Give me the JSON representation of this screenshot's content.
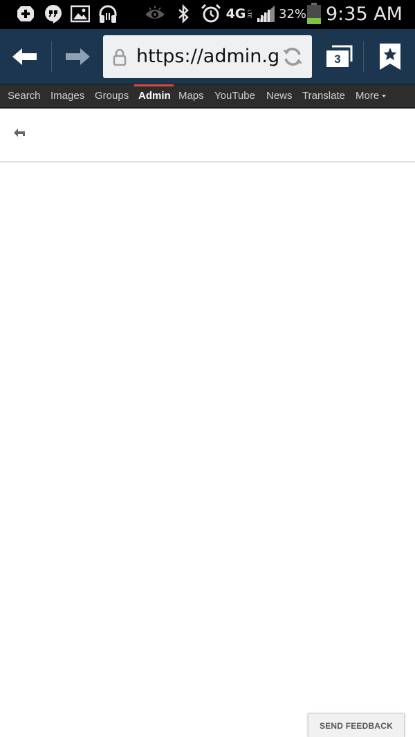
{
  "status_bar": {
    "icons": [
      "google-plus-icon",
      "hangouts-icon",
      "gallery-icon",
      "headphones-icon",
      "eye-icon",
      "bluetooth-icon",
      "alarm-icon",
      "4g-lte-icon",
      "signal-icon",
      "battery-icon"
    ],
    "network": "4G",
    "network_sub": "LTE",
    "battery_percent": "32%",
    "battery_level": 0.32,
    "time": "9:35 AM"
  },
  "browser": {
    "url": "https://admin.google.com",
    "tab_count": "3",
    "colors": {
      "toolbar": "#1d3650",
      "url_box": "#eef0f2"
    }
  },
  "google_bar": {
    "items": [
      "Search",
      "Images",
      "Groups",
      "Admin",
      "Maps",
      "YouTube",
      "News",
      "Translate",
      "More"
    ],
    "active": "Admin",
    "accent_color": "#dd4b39"
  },
  "page": {
    "feedback_label": "SEND FEEDBACK"
  }
}
